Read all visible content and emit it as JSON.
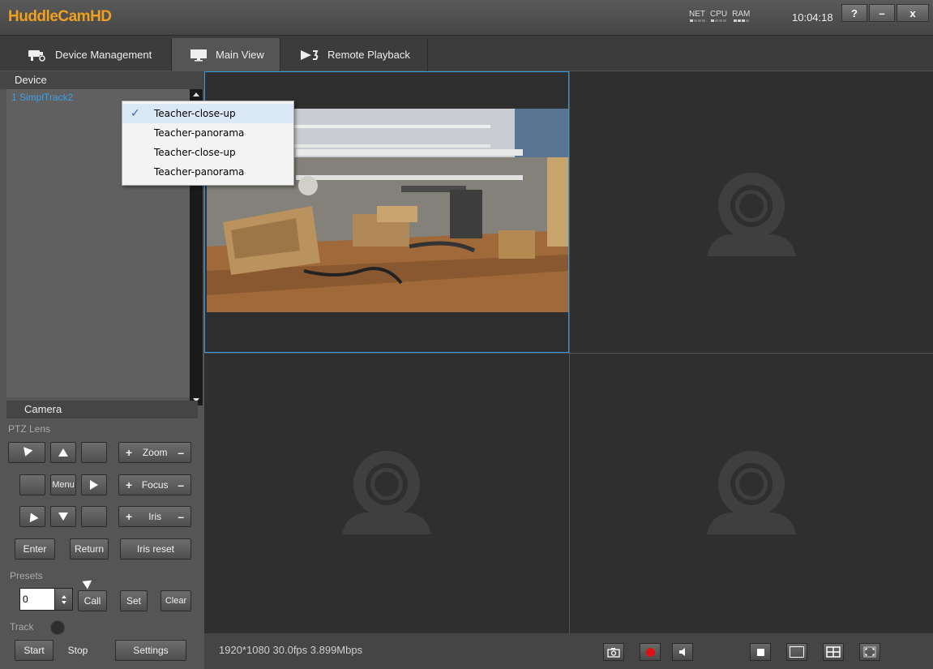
{
  "app": {
    "title": "HuddleCamHD",
    "clock": "10:04:18"
  },
  "meters": [
    {
      "label": "NET",
      "level": 1
    },
    {
      "label": "CPU",
      "level": 1
    },
    {
      "label": "RAM",
      "level": 3
    }
  ],
  "window_buttons": {
    "help": "?",
    "minimize": "–",
    "close": "x"
  },
  "tabs": [
    {
      "label": "Device Management",
      "icon": "camera-icon"
    },
    {
      "label": "Main View",
      "icon": "monitor-icon",
      "active": true
    },
    {
      "label": "Remote Playback",
      "icon": "playback-icon"
    }
  ],
  "device_panel": {
    "header": "Device",
    "items": [
      {
        "label": "1  SimplTrack2"
      }
    ]
  },
  "dropdown": {
    "items": [
      {
        "label": "Teacher-close-up",
        "checked": true
      },
      {
        "label": "Teacher-panorama",
        "checked": false
      },
      {
        "label": "Teacher-close-up",
        "checked": false
      },
      {
        "label": "Teacher-panorama",
        "checked": false
      }
    ]
  },
  "camera_panel": {
    "header": "Camera",
    "ptz_label": "PTZ Lens",
    "menu": "Menu",
    "zoom": {
      "plus": "+",
      "label": "Zoom",
      "minus": "–"
    },
    "focus": {
      "plus": "+",
      "label": "Focus",
      "minus": "–"
    },
    "iris": {
      "plus": "+",
      "label": "Iris",
      "minus": "–"
    },
    "enter": "Enter",
    "return": "Return",
    "iris_reset": "Iris reset",
    "presets_label": "Presets",
    "preset_value": "0",
    "call": "Call",
    "set": "Set",
    "clear": "Clear",
    "track_label": "Track",
    "start": "Start",
    "stop": "Stop",
    "settings": "Settings"
  },
  "status": {
    "stream_info": "1920*1080 30.0fps 3.899Mbps"
  },
  "colors": {
    "accent": "#2e9ae0",
    "brand": "#f0a020",
    "device_link": "#3aa0e8",
    "record": "#e01010"
  }
}
